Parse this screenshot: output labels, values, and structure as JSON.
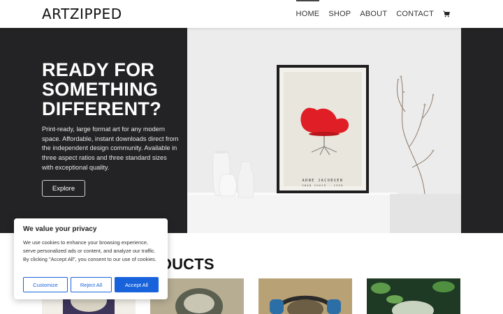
{
  "header": {
    "logo": "ARTZIPPED",
    "nav": [
      {
        "label": "HOME",
        "active": true
      },
      {
        "label": "SHOP",
        "active": false
      },
      {
        "label": "ABOUT",
        "active": false
      },
      {
        "label": "CONTACT",
        "active": false
      }
    ],
    "cart_icon": "shopping-cart-icon"
  },
  "hero": {
    "title": "READY FOR SOMETHING DIFFERENT?",
    "text": "Print-ready, large format art for any modern space. Affordable, instant downloads direct from the independent design community. Available in three aspect ratios and three standard sizes with exceptional quality.",
    "button": "Explore",
    "poster_line1": "ARNE JACOBSEN",
    "poster_line2": "SWAN CHAIR - 1958"
  },
  "products": {
    "title": "PRODUCTS",
    "visible_title_text": "DUCTS"
  },
  "cookie": {
    "title": "We value your privacy",
    "text": "We use cookies to enhance your browsing experience, serve personalized ads or content, and analyze our traffic. By clicking \"Accept All\", you consent to our use of cookies.",
    "customize": "Customize",
    "reject": "Reject All",
    "accept": "Accept All"
  },
  "colors": {
    "hero_bg": "#232325",
    "accent_blue": "#1863dc",
    "chair_red": "#e01e25"
  }
}
